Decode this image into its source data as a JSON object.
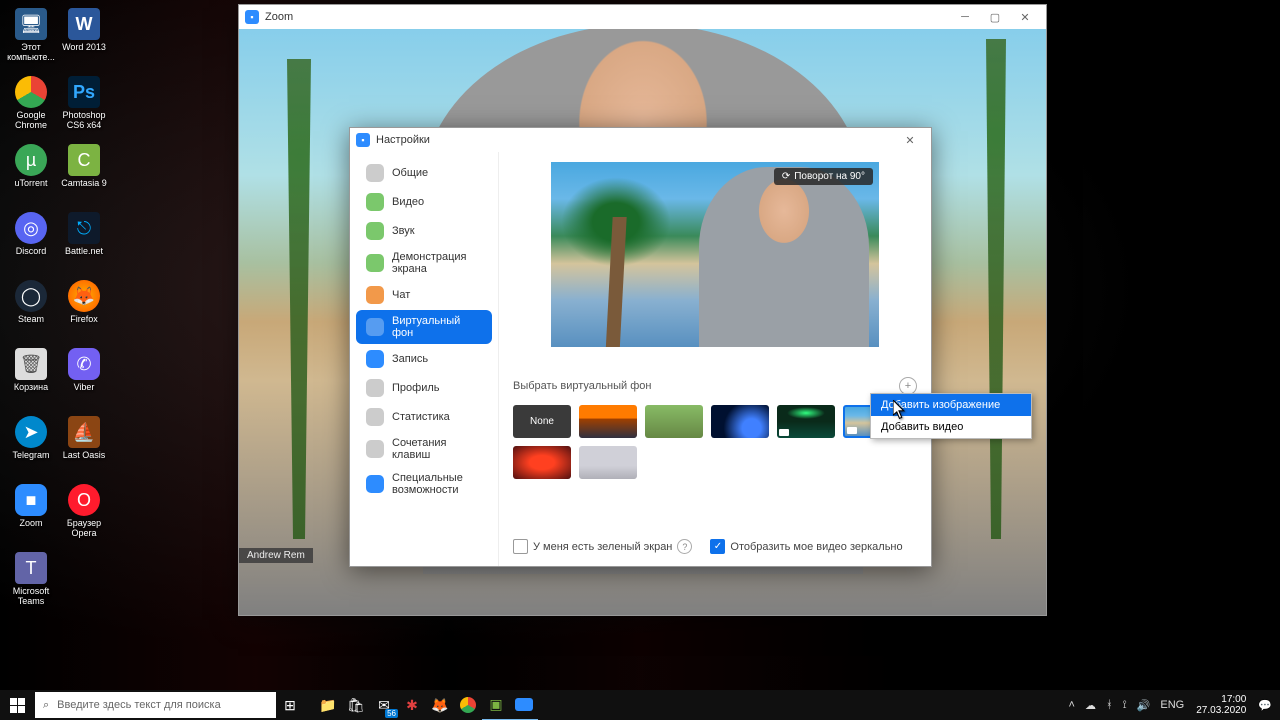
{
  "desktop_icons": [
    {
      "label": "Этот компьюте...",
      "cls": "pc",
      "glyph": "🖥"
    },
    {
      "label": "Word 2013",
      "cls": "word",
      "glyph": "W"
    },
    {
      "label": "Google Chrome",
      "cls": "chrome",
      "glyph": ""
    },
    {
      "label": "Photoshop CS6 x64",
      "cls": "ps",
      "glyph": "Ps"
    },
    {
      "label": "uTorrent",
      "cls": "ut",
      "glyph": "µ"
    },
    {
      "label": "Camtasia 9",
      "cls": "cam",
      "glyph": "C"
    },
    {
      "label": "Discord",
      "cls": "disc",
      "glyph": "◎"
    },
    {
      "label": "Battle.net",
      "cls": "bnet",
      "glyph": "⎋"
    },
    {
      "label": "Steam",
      "cls": "steam",
      "glyph": "◯"
    },
    {
      "label": "Firefox",
      "cls": "ff",
      "glyph": "🦊"
    },
    {
      "label": "Корзина",
      "cls": "trash",
      "glyph": "🗑"
    },
    {
      "label": "Viber",
      "cls": "viber",
      "glyph": "✆"
    },
    {
      "label": "Telegram",
      "cls": "tg",
      "glyph": "➤"
    },
    {
      "label": "Last Oasis",
      "cls": "lo",
      "glyph": "⛵"
    },
    {
      "label": "Zoom",
      "cls": "zoom",
      "glyph": "■"
    },
    {
      "label": "Браузер Opera",
      "cls": "opera",
      "glyph": "O"
    },
    {
      "label": "Microsoft Teams",
      "cls": "teams",
      "glyph": "T"
    }
  ],
  "zoom_main": {
    "title": "Zoom",
    "nametag": "Andrew Rem"
  },
  "settings": {
    "title": "Настройки",
    "nav": [
      {
        "label": "Общие",
        "cls": "gen"
      },
      {
        "label": "Видео",
        "cls": "vid"
      },
      {
        "label": "Звук",
        "cls": "aud"
      },
      {
        "label": "Демонстрация экрана",
        "cls": "shr"
      },
      {
        "label": "Чат",
        "cls": "chat"
      },
      {
        "label": "Виртуальный фон",
        "cls": "vb",
        "active": true
      },
      {
        "label": "Запись",
        "cls": "rec"
      },
      {
        "label": "Профиль",
        "cls": "prof"
      },
      {
        "label": "Статистика",
        "cls": "stat"
      },
      {
        "label": "Сочетания клавиш",
        "cls": "keys"
      },
      {
        "label": "Специальные возможности",
        "cls": "acc"
      }
    ],
    "rotate": "Поворот на 90°",
    "section_title": "Выбрать виртуальный фон",
    "none_label": "None",
    "green_screen": "У меня есть зеленый экран",
    "mirror": "Отобразить мое видео зеркально",
    "context_menu": {
      "add_image": "Добавить изображение",
      "add_video": "Добавить видео"
    }
  },
  "taskbar": {
    "search_placeholder": "Введите здесь текст для поиска",
    "lang": "ENG",
    "time": "17:00",
    "date": "27.03.2020",
    "mail_count": "56"
  }
}
